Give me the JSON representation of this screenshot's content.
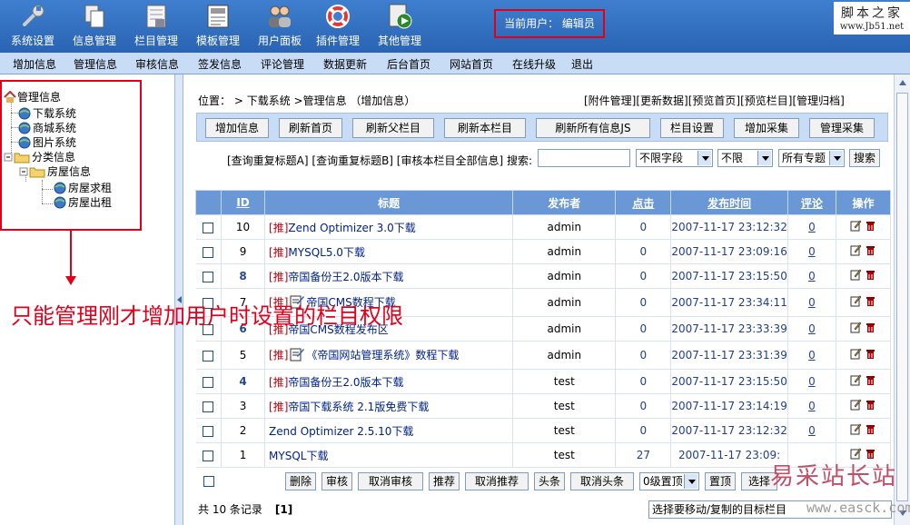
{
  "toolbar": {
    "items": [
      {
        "label": "系统设置",
        "icon": "wrench-icon"
      },
      {
        "label": "信息管理",
        "icon": "documents-icon"
      },
      {
        "label": "栏目管理",
        "icon": "columns-icon"
      },
      {
        "label": "模板管理",
        "icon": "template-icon"
      },
      {
        "label": "用户面板",
        "icon": "users-icon"
      },
      {
        "label": "插件管理",
        "icon": "lifebuoy-icon"
      },
      {
        "label": "其他管理",
        "icon": "play-document-icon"
      }
    ],
    "current_user_label": "当前用户：",
    "current_user": "编辑员"
  },
  "site_logo": {
    "line1": "脚本之家",
    "line2": "www.Jb51.net"
  },
  "menu": [
    "增加信息",
    "管理信息",
    "审核信息",
    "签发信息",
    "评论管理",
    "数据更新",
    "后台首页",
    "网站首页",
    "在线升级",
    "退出"
  ],
  "tree": {
    "root": "管理信息",
    "items": [
      "下载系统",
      "商城系统",
      "图片系统",
      "分类信息",
      "房屋信息",
      "房屋求租",
      "房屋出租"
    ]
  },
  "annotation": "只能管理刚才增加用户时设置的栏目权限",
  "breadcrumb": {
    "label": "位置：",
    "path": " > 下载系统 >管理信息 （增加信息）"
  },
  "top_links": [
    "[附件管理]",
    "[更新数据]",
    "[预览首页]",
    "[预览栏目]",
    "[管理归档]"
  ],
  "action_buttons": [
    "增加信息",
    "刷新首页",
    "刷新父栏目",
    "刷新本栏目",
    "刷新所有信息JS",
    "栏目设置",
    "增加采集",
    "管理采集"
  ],
  "search": {
    "links": "[查询重复标题A] [查询重复标题B] [审核本栏目全部信息] 搜索:",
    "keyword": "",
    "field_select": "不限字段",
    "level_select": "不限",
    "topic_select": "所有专题",
    "button": "搜索"
  },
  "table": {
    "headers": [
      "ID",
      "标题",
      "发布者",
      "点击",
      "发布时间",
      "评论",
      "操作"
    ],
    "rows": [
      {
        "id": "10",
        "tag": "[推]",
        "title": "Zend Optimizer 3.0下载",
        "publisher": "admin",
        "clicks": "0",
        "time": "2007-11-17 23:12:32",
        "comments": "0",
        "bold": false,
        "pic": false
      },
      {
        "id": "9",
        "tag": "[推]",
        "title": "MYSQL5.0下载",
        "publisher": "admin",
        "clicks": "0",
        "time": "2007-11-17 23:09:16",
        "comments": "0",
        "bold": false,
        "pic": false
      },
      {
        "id": "8",
        "tag": "[推]",
        "title": "帝国备份王2.0版本下载",
        "publisher": "admin",
        "clicks": "0",
        "time": "2007-11-17 23:15:50",
        "comments": "0",
        "bold": true,
        "pic": false
      },
      {
        "id": "7",
        "tag": "[推]",
        "title": "帝国CMS数程下载",
        "publisher": "admin",
        "clicks": "0",
        "time": "2007-11-17 23:34:11",
        "comments": "0",
        "bold": false,
        "pic": true
      },
      {
        "id": "6",
        "tag": "[推]",
        "title": "帝国CMS数程发布区",
        "publisher": "admin",
        "clicks": "0",
        "time": "2007-11-17 23:33:39",
        "comments": "0",
        "bold": true,
        "pic": false
      },
      {
        "id": "5",
        "tag": "[推]",
        "title": "《帝国网站管理系统》数程下载",
        "publisher": "admin",
        "clicks": "0",
        "time": "2007-11-17 23:31:39",
        "comments": "0",
        "bold": false,
        "pic": true
      },
      {
        "id": "4",
        "tag": "[推]",
        "title": "帝国备份王2.0版本下载",
        "publisher": "test",
        "clicks": "0",
        "time": "2007-11-17 23:15:50",
        "comments": "0",
        "bold": true,
        "pic": false
      },
      {
        "id": "3",
        "tag": "[推]",
        "title": "帝国下载系统 2.1版免费下载",
        "publisher": "test",
        "clicks": "0",
        "time": "2007-11-17 23:14:19",
        "comments": "0",
        "bold": false,
        "pic": false
      },
      {
        "id": "2",
        "tag": "",
        "title": "Zend Optimizer 2.5.10下载",
        "publisher": "test",
        "clicks": "0",
        "time": "2007-11-17 23:12:32",
        "comments": "0",
        "bold": false,
        "pic": false
      },
      {
        "id": "1",
        "tag": "",
        "title": "MYSQL下载",
        "publisher": "test",
        "clicks": "27",
        "time": "2007-11-17 23:09:",
        "comments": "",
        "bold": false,
        "pic": false
      }
    ]
  },
  "bottom_buttons": [
    "删除",
    "审核",
    "取消审核",
    "推荐",
    "取消推荐",
    "头条",
    "取消头条"
  ],
  "level_select": "0级置顶",
  "top_button": "置顶",
  "select_button": "选择",
  "footer": {
    "total": "共 10 条记录",
    "page": "[1]"
  },
  "target_select": "选择要移动/复制的目标栏目",
  "watermark": {
    "line1": "易采站长站",
    "line2": "www.easck.com"
  },
  "colors": {
    "accent": "#2a63b3",
    "header": "#6a98d6",
    "annotation": "#e0001b",
    "tag": "#c0000e"
  }
}
